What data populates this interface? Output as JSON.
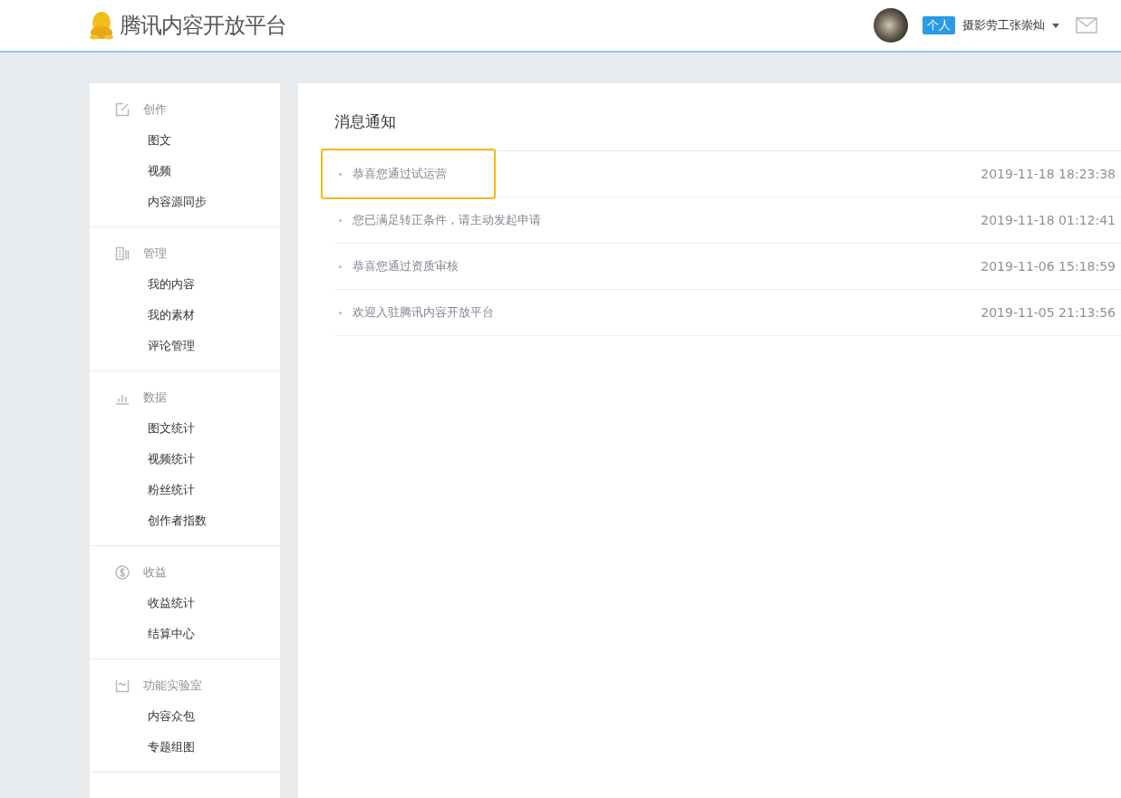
{
  "header": {
    "logo_text": "腾讯内容开放平台",
    "account_badge": "个人",
    "username": "摄影劳工张崇灿"
  },
  "sidebar": {
    "groups": [
      {
        "title": "创作",
        "items": [
          "图文",
          "视频",
          "内容源同步"
        ]
      },
      {
        "title": "管理",
        "items": [
          "我的内容",
          "我的素材",
          "评论管理"
        ]
      },
      {
        "title": "数据",
        "items": [
          "图文统计",
          "视频统计",
          "粉丝统计",
          "创作者指数"
        ]
      },
      {
        "title": "收益",
        "items": [
          "收益统计",
          "结算中心"
        ]
      },
      {
        "title": "功能实验室",
        "items": [
          "内容众包",
          "专题组图"
        ]
      }
    ]
  },
  "main": {
    "title": "消息通知",
    "messages": [
      {
        "text": "恭喜您通过试运营",
        "time": "2019-11-18 18:23:38",
        "highlighted": true
      },
      {
        "text": "您已满足转正条件，请主动发起申请",
        "time": "2019-11-18 01:12:41",
        "highlighted": false
      },
      {
        "text": "恭喜您通过资质审核",
        "time": "2019-11-06 15:18:59",
        "highlighted": false
      },
      {
        "text": "欢迎入驻腾讯内容开放平台",
        "time": "2019-11-05 21:13:56",
        "highlighted": false
      }
    ]
  }
}
